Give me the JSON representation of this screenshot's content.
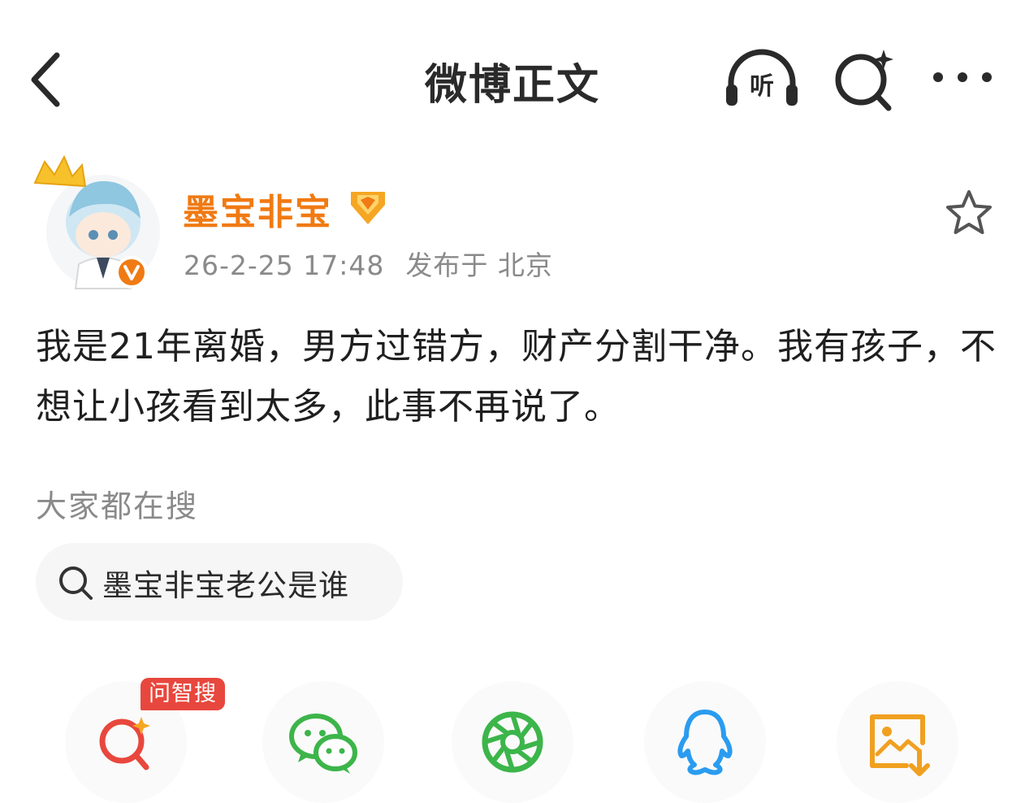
{
  "header": {
    "title": "微博正文",
    "listen_label": "听"
  },
  "post": {
    "author": "墨宝非宝",
    "timestamp": "26-2-25 17:48",
    "location": "发布于 北京",
    "content": "我是21年离婚，男方过错方，财产分割干净。我有孩子，不想让小孩看到太多，此事不再说了。"
  },
  "trending": {
    "heading": "大家都在搜",
    "chip_text": "墨宝非宝老公是谁"
  },
  "share_bar": {
    "ai_search_tag": "问智搜",
    "items": [
      "ai-search-icon",
      "wechat-icon",
      "moments-icon",
      "qq-icon",
      "save-image-icon"
    ]
  },
  "colors": {
    "accent_orange": "#f07a13",
    "ai_red": "#e8473d",
    "wechat_green": "#3cb54a",
    "qq_blue": "#2a9cf0",
    "save_orange": "#f0a020"
  }
}
